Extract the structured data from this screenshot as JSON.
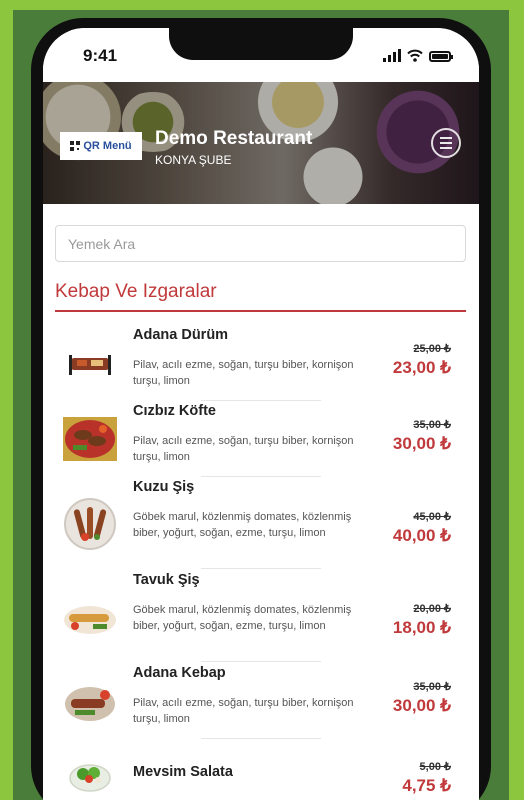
{
  "status_bar": {
    "time": "9:41"
  },
  "header": {
    "logo_text": "QR Menü",
    "restaurant_name": "Demo Restaurant",
    "branch": "KONYA ŞUBE"
  },
  "search": {
    "placeholder": "Yemek Ara",
    "value": ""
  },
  "category": {
    "title": "Kebap Ve Izgaralar"
  },
  "items": [
    {
      "name": "Adana Dürüm",
      "description": "Pilav, acılı ezme, soğan, turşu biber, kornişon turşu, limon",
      "old_price": "25,00 ₺",
      "price": "23,00 ₺"
    },
    {
      "name": "Cızbız Köfte",
      "description": "Pilav, acılı ezme, soğan, turşu biber, kornişon turşu, limon",
      "old_price": "35,00 ₺",
      "price": "30,00 ₺"
    },
    {
      "name": "Kuzu Şiş",
      "description": "Göbek marul, közlenmiş domates, közlenmiş biber, yoğurt, soğan, ezme, turşu, limon",
      "old_price": "45,00 ₺",
      "price": "40,00 ₺"
    },
    {
      "name": "Tavuk Şiş",
      "description": "Göbek marul, közlenmiş domates, közlenmiş biber, yoğurt, soğan, ezme, turşu, limon",
      "old_price": "20,00 ₺",
      "price": "18,00 ₺"
    },
    {
      "name": "Adana Kebap",
      "description": "Pilav, acılı ezme, soğan, turşu biber, kornişon turşu, limon",
      "old_price": "35,00 ₺",
      "price": "30,00 ₺"
    },
    {
      "name": "Mevsim Salata",
      "description": "",
      "old_price": "5,00 ₺",
      "price": "4,75 ₺"
    }
  ],
  "colors": {
    "accent": "#c0393b",
    "background": "#8cc63f"
  }
}
